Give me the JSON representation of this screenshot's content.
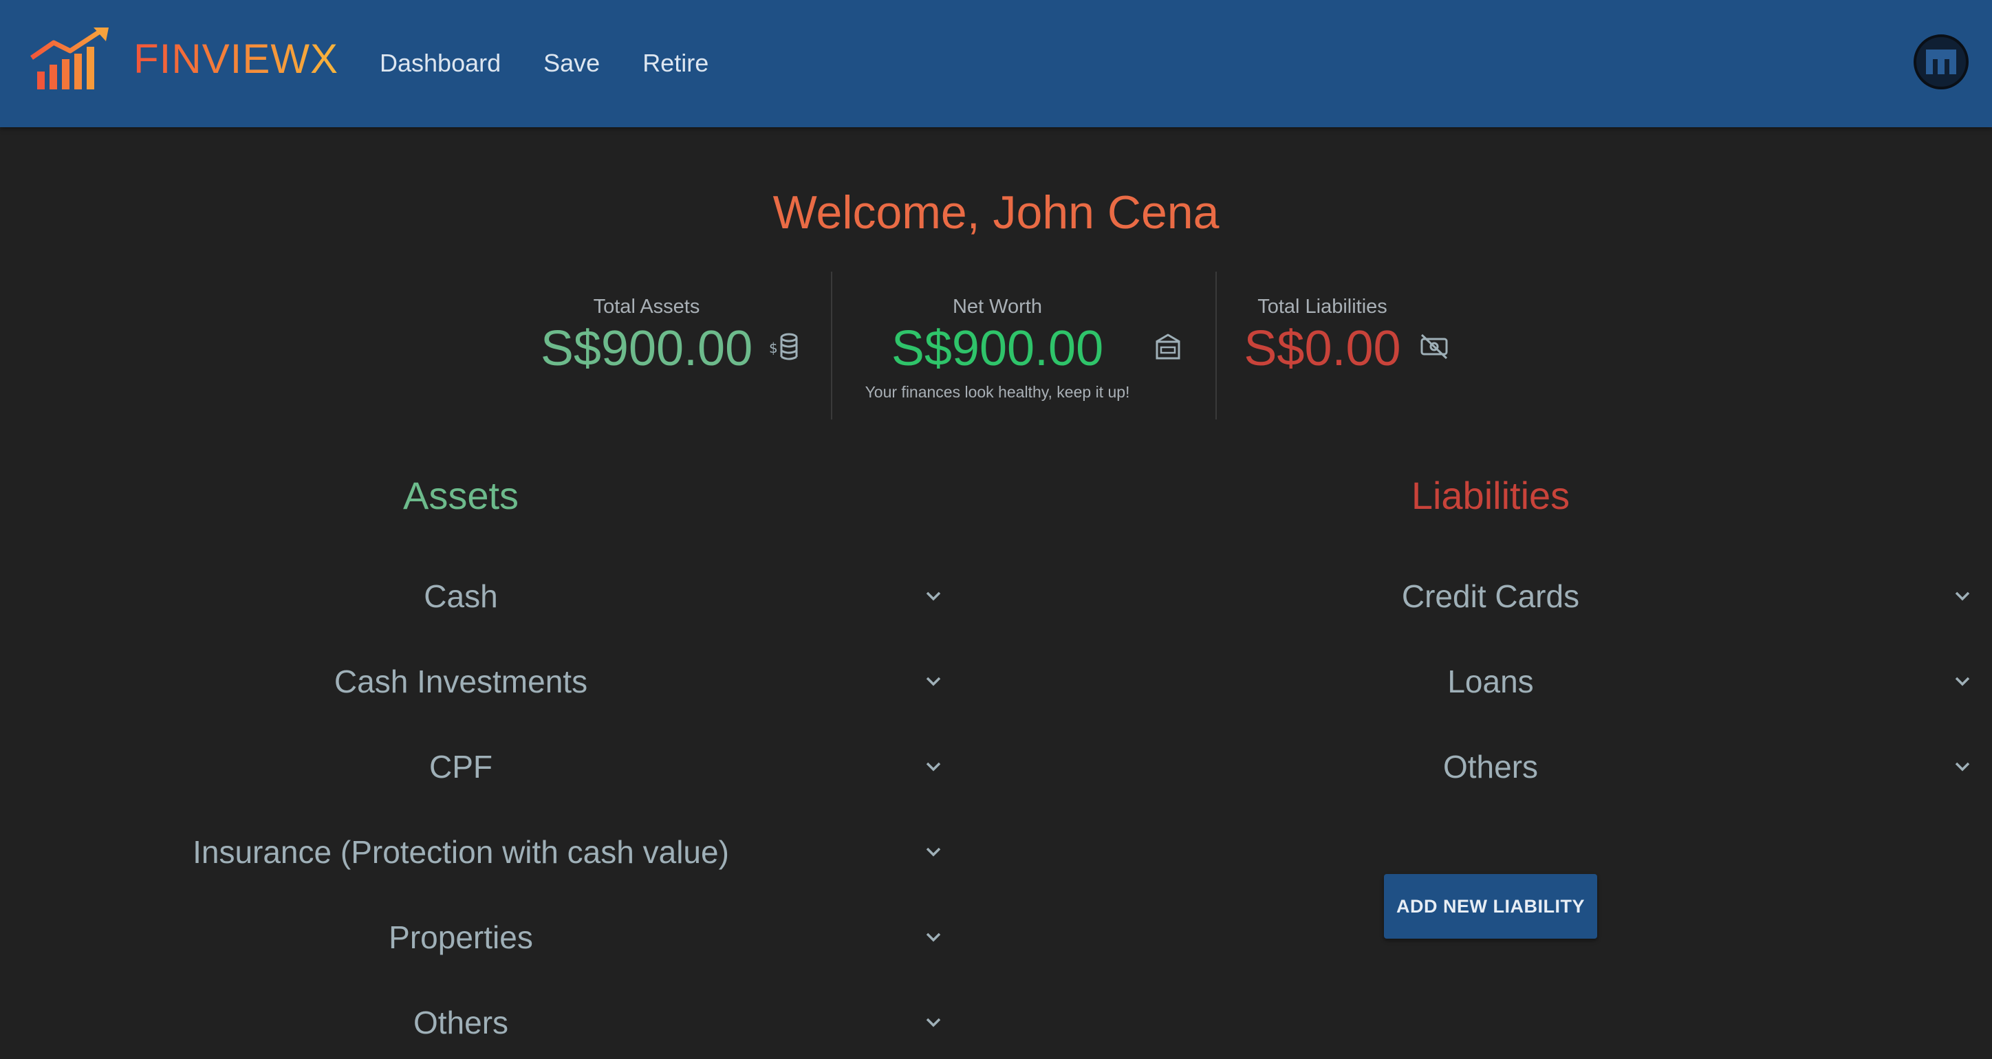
{
  "app": {
    "brand": "FINVIEWX"
  },
  "nav": [
    {
      "label": "Dashboard"
    },
    {
      "label": "Save"
    },
    {
      "label": "Retire"
    }
  ],
  "welcome": "Welcome, John Cena",
  "stats": {
    "total_assets": {
      "label": "Total Assets",
      "value": "S$900.00",
      "icon": "coins-icon"
    },
    "net_worth": {
      "label": "Net Worth",
      "value": "S$900.00",
      "note": "Your finances look healthy, keep it up!",
      "icon": "bank-icon"
    },
    "total_liabilities": {
      "label": "Total Liabilities",
      "value": "S$0.00",
      "icon": "no-money-icon"
    }
  },
  "assets": {
    "title": "Assets",
    "items": [
      {
        "label": "Cash"
      },
      {
        "label": "Cash Investments"
      },
      {
        "label": "CPF"
      },
      {
        "label": "Insurance (Protection with cash value)"
      },
      {
        "label": "Properties"
      },
      {
        "label": "Others"
      }
    ]
  },
  "liabilities": {
    "title": "Liabilities",
    "items": [
      {
        "label": "Credit Cards"
      },
      {
        "label": "Loans"
      },
      {
        "label": "Others"
      }
    ],
    "add_button": "ADD NEW LIABILITY"
  },
  "colors": {
    "header": "#1f5085",
    "background": "#212121",
    "assets_green": "#6dbb8c",
    "net_worth_green": "#2fc46a",
    "liabilities_red": "#c9433a",
    "welcome_orange": "#ea6b45"
  }
}
